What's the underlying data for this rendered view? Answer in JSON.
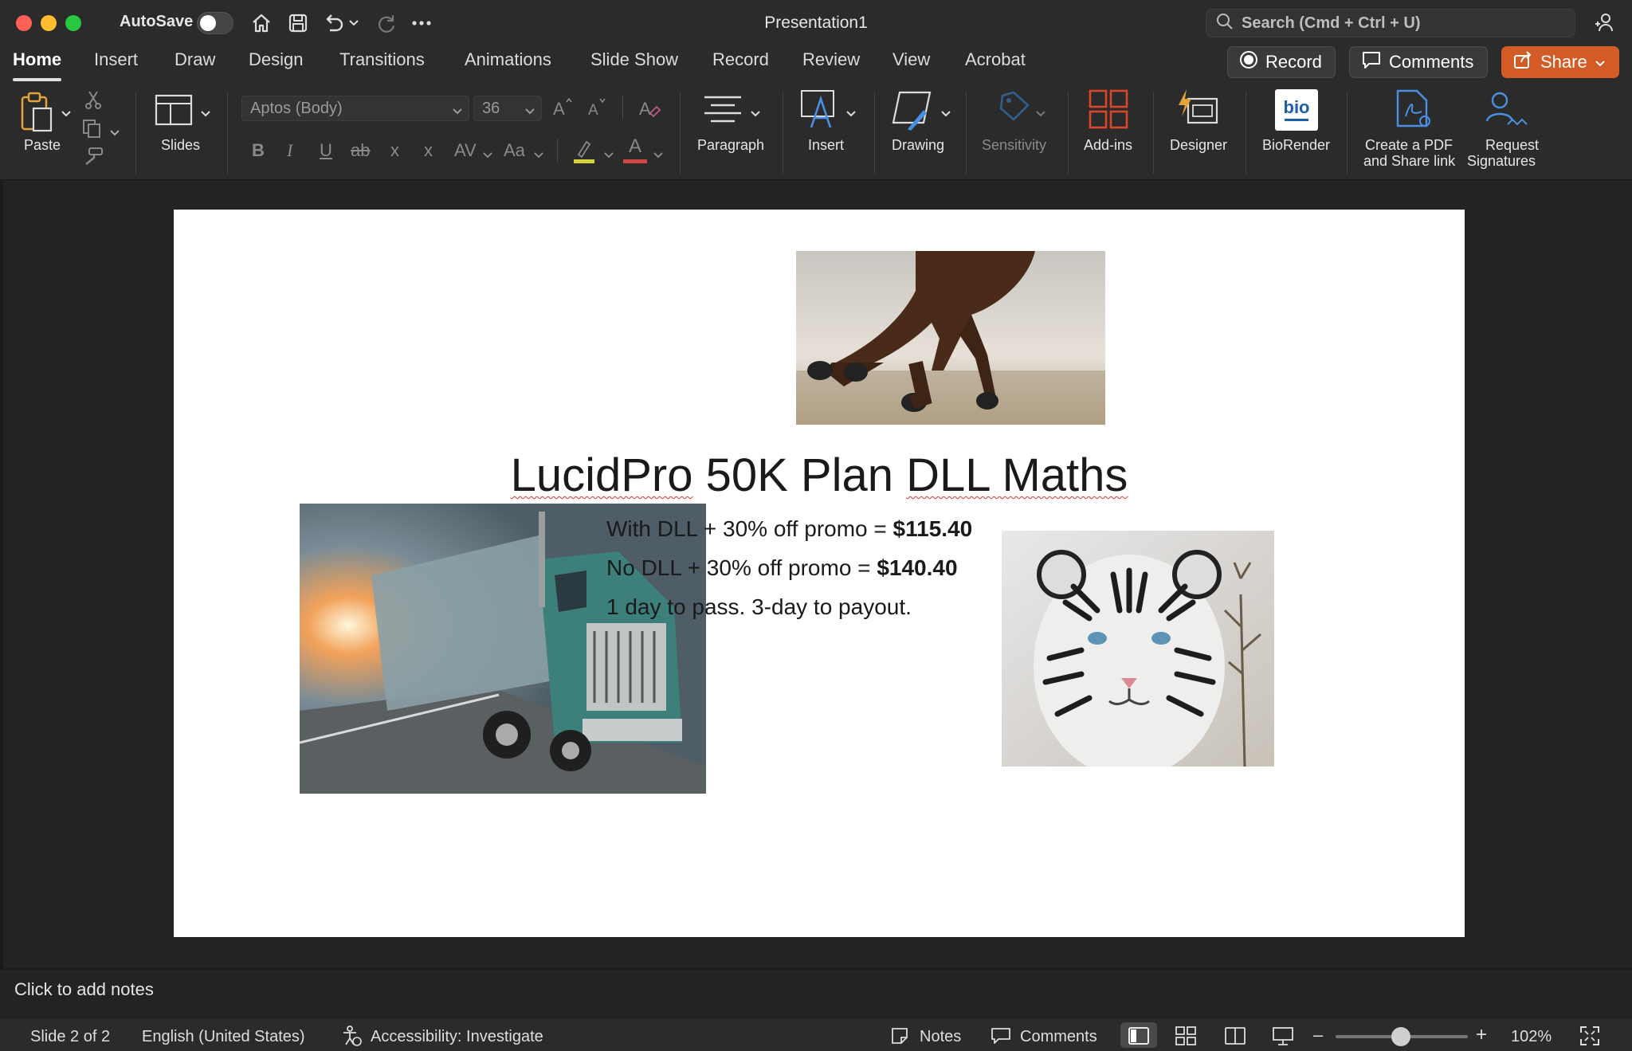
{
  "window": {
    "autosave_label": "AutoSave",
    "doc_title": "Presentation1",
    "search_placeholder": "Search (Cmd + Ctrl + U)"
  },
  "tabs": [
    "Home",
    "Insert",
    "Draw",
    "Design",
    "Transitions",
    "Animations",
    "Slide Show",
    "Record",
    "Review",
    "View",
    "Acrobat"
  ],
  "top_buttons": {
    "record": "Record",
    "comments": "Comments",
    "share": "Share"
  },
  "ribbon": {
    "paste": "Paste",
    "slides": "Slides",
    "font_name": "Aptos (Body)",
    "font_size": "36",
    "paragraph": "Paragraph",
    "insert": "Insert",
    "drawing": "Drawing",
    "sensitivity": "Sensitivity",
    "addins": "Add-ins",
    "designer": "Designer",
    "biorender": "BioRender",
    "biorender_logo": "bio",
    "create_pdf_line1": "Create a PDF",
    "create_pdf_line2": "and Share link",
    "request_line1": "Request",
    "request_line2": "Signatures",
    "format_bold": "B",
    "format_italic": "I",
    "format_underline": "U",
    "format_strike": "ab",
    "format_super": "x",
    "format_sub": "x",
    "format_spacing": "AV",
    "format_case": "Aa",
    "font_color_letter": "A"
  },
  "slide": {
    "title_part1": "LucidPro",
    "title_part2": " 50K Plan ",
    "title_part3": "DLL Maths",
    "bullet1_text": "With DLL + 30% off promo = ",
    "bullet1_value": "$115.40",
    "bullet2_text": "No DLL + 30% off promo = ",
    "bullet2_value": "$140.40",
    "bullet3_text": "1 day to pass. 3-day to payout."
  },
  "notes_placeholder": "Click to add notes",
  "status": {
    "slide_count": "Slide 2 of 2",
    "language": "English (United States)",
    "accessibility": "Accessibility: Investigate",
    "notes": "Notes",
    "comments": "Comments",
    "zoom": "102%"
  },
  "colors": {
    "share_accent": "#d35b26",
    "record_dot": "#ffffff",
    "addins_icon": "#d9472b",
    "acrobat_icon": "#4a90e2"
  }
}
